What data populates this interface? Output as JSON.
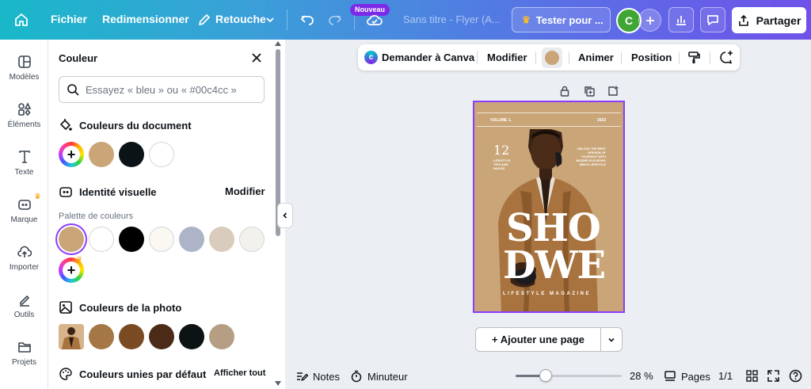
{
  "topbar": {
    "menu_file": "Fichier",
    "menu_resize": "Redimensionner",
    "menu_edit": "Retouche",
    "badge_new": "Nouveau",
    "doc_title": "Sans titre - Flyer (A...",
    "try_pro": "Tester pour ...",
    "avatar_initial": "C",
    "share": "Partager"
  },
  "rail": {
    "items": [
      {
        "label": "Modèles",
        "icon": "templates-icon"
      },
      {
        "label": "Éléments",
        "icon": "elements-icon"
      },
      {
        "label": "Texte",
        "icon": "text-icon"
      },
      {
        "label": "Marque",
        "icon": "brand-icon"
      },
      {
        "label": "Importer",
        "icon": "upload-icon"
      },
      {
        "label": "Outils",
        "icon": "tools-icon"
      },
      {
        "label": "Projets",
        "icon": "projects-icon"
      }
    ]
  },
  "panel": {
    "title": "Couleur",
    "search_placeholder": "Essayez « bleu » ou « #00c4cc »",
    "document_colors": {
      "title": "Couleurs du document",
      "colors": [
        "#c9a578",
        "#0c1316",
        "#ffffff"
      ]
    },
    "brand": {
      "title": "Identité visuelle",
      "action": "Modifier",
      "palette_label": "Palette de couleurs",
      "colors": [
        "#c9a578",
        "#ffffff",
        "#000000",
        "#fbf8f1",
        "#aeb4c8",
        "#d9ccbc",
        "#f3f1ec"
      ]
    },
    "photo": {
      "title": "Couleurs de la photo",
      "colors": [
        "#a57744",
        "#7a4a23",
        "#4b2a17",
        "#0d1215",
        "#b59e84"
      ]
    },
    "defaults": {
      "title": "Couleurs unies par défaut",
      "action": "Afficher tout"
    }
  },
  "context_toolbar": {
    "ask_canva": "Demander à Canva",
    "edit": "Modifier",
    "color_value": "#c9a578",
    "animate": "Animer",
    "position": "Position"
  },
  "page": {
    "volume": "VOLUME 1.",
    "year": "2023",
    "number": "12",
    "left_caption": "LIFESTYLE TIPS AND HACKS",
    "right_caption": "UNLOCK THE BEST VERSION OF YOURSELF WITH INSIDER ELEVATING MEN'S LIFESTYLE",
    "headline_1": "SHO",
    "headline_2": "DWE",
    "magazine": "LIFESTYLE MAGAZINE",
    "background": "#c9a578"
  },
  "add_page": "+ Ajouter une page",
  "bottombar": {
    "notes": "Notes",
    "timer": "Minuteur",
    "zoom": "28 %",
    "zoom_fraction": 0.28,
    "pages": "Pages",
    "page_count": "1/1"
  }
}
